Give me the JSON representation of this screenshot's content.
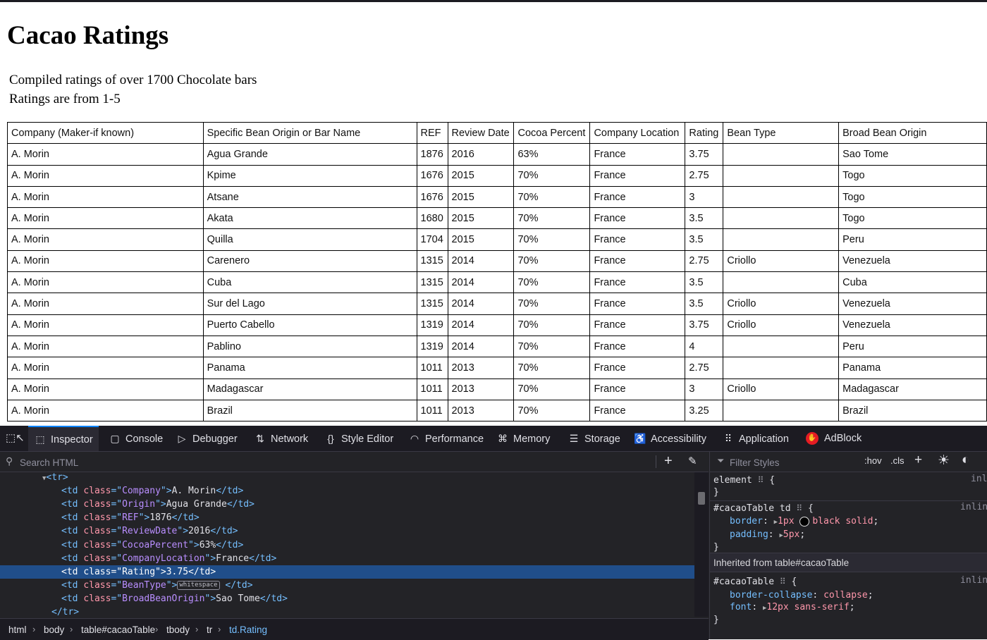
{
  "page": {
    "title": "Cacao Ratings",
    "subtitle_line1": "Compiled ratings of over 1700 Chocolate bars",
    "subtitle_line2": "Ratings are from 1-5"
  },
  "table": {
    "headers": [
      "Company  (Maker-if known)",
      "Specific Bean Origin or Bar Name",
      "REF",
      "Review Date",
      "Cocoa Percent",
      "Company Location",
      "Rating",
      "Bean Type",
      "Broad Bean Origin"
    ],
    "rows": [
      [
        "A. Morin",
        "Agua Grande",
        "1876",
        "2016",
        "63%",
        "France",
        "3.75",
        "",
        "Sao Tome"
      ],
      [
        "A. Morin",
        "Kpime",
        "1676",
        "2015",
        "70%",
        "France",
        "2.75",
        "",
        "Togo"
      ],
      [
        "A. Morin",
        "Atsane",
        "1676",
        "2015",
        "70%",
        "France",
        "3",
        "",
        "Togo"
      ],
      [
        "A. Morin",
        "Akata",
        "1680",
        "2015",
        "70%",
        "France",
        "3.5",
        "",
        "Togo"
      ],
      [
        "A. Morin",
        "Quilla",
        "1704",
        "2015",
        "70%",
        "France",
        "3.5",
        "",
        "Peru"
      ],
      [
        "A. Morin",
        "Carenero",
        "1315",
        "2014",
        "70%",
        "France",
        "2.75",
        "Criollo",
        "Venezuela"
      ],
      [
        "A. Morin",
        "Cuba",
        "1315",
        "2014",
        "70%",
        "France",
        "3.5",
        "",
        "Cuba"
      ],
      [
        "A. Morin",
        "Sur del Lago",
        "1315",
        "2014",
        "70%",
        "France",
        "3.5",
        "Criollo",
        "Venezuela"
      ],
      [
        "A. Morin",
        "Puerto Cabello",
        "1319",
        "2014",
        "70%",
        "France",
        "3.75",
        "Criollo",
        "Venezuela"
      ],
      [
        "A. Morin",
        "Pablino",
        "1319",
        "2014",
        "70%",
        "France",
        "4",
        "",
        "Peru"
      ],
      [
        "A. Morin",
        "Panama",
        "1011",
        "2013",
        "70%",
        "France",
        "2.75",
        "",
        "Panama"
      ],
      [
        "A. Morin",
        "Madagascar",
        "1011",
        "2013",
        "70%",
        "France",
        "3",
        "Criollo",
        "Madagascar"
      ],
      [
        "A. Morin",
        "Brazil",
        "1011",
        "2013",
        "70%",
        "France",
        "3.25",
        "",
        "Brazil"
      ]
    ]
  },
  "devtools": {
    "tabs": [
      {
        "label": "Inspector",
        "icon": "inspector-icon"
      },
      {
        "label": "Console",
        "icon": "console-icon"
      },
      {
        "label": "Debugger",
        "icon": "debugger-icon"
      },
      {
        "label": "Network",
        "icon": "network-icon"
      },
      {
        "label": "Style Editor",
        "icon": "style-editor-icon"
      },
      {
        "label": "Performance",
        "icon": "performance-icon"
      },
      {
        "label": "Memory",
        "icon": "memory-icon"
      },
      {
        "label": "Storage",
        "icon": "storage-icon"
      },
      {
        "label": "Accessibility",
        "icon": "accessibility-icon"
      },
      {
        "label": "Application",
        "icon": "application-icon"
      },
      {
        "label": "AdBlock",
        "icon": "adblock-icon"
      }
    ],
    "active_tab": "Inspector",
    "search_placeholder": "Search HTML",
    "html_tree": {
      "open_tag": "<tr>",
      "close_tag": "</tr>",
      "cells": [
        {
          "cls": "Company",
          "text": "A. Morin"
        },
        {
          "cls": "Origin",
          "text": "Agua Grande"
        },
        {
          "cls": "REF",
          "text": "1876"
        },
        {
          "cls": "ReviewDate",
          "text": "2016"
        },
        {
          "cls": "CocoaPercent",
          "text": "63%"
        },
        {
          "cls": "CompanyLocation",
          "text": "France"
        },
        {
          "cls": "Rating",
          "text": "3.75",
          "selected": true
        },
        {
          "cls": "BeanType",
          "text": "",
          "whitespace": "whitespace"
        },
        {
          "cls": "BroadBeanOrigin",
          "text": "Sao Tome"
        }
      ]
    },
    "breadcrumbs": [
      "html",
      "body",
      "table#cacaoTable",
      "tbody",
      "tr",
      "td.Rating"
    ],
    "styles": {
      "filter_placeholder": "Filter Styles",
      "hov": ":hov",
      "cls": ".cls",
      "element_selector": "element",
      "element_src": "inl",
      "rule1_selector": "#cacaoTable td",
      "rule1_src": "inlin",
      "rule1_border_prop": "border",
      "rule1_border_val_a": "1px",
      "rule1_border_val_b": "black solid",
      "rule1_padding_prop": "padding",
      "rule1_padding_val": "5px",
      "inherited_label": "Inherited from table#cacaoTable",
      "rule2_selector": "#cacaoTable",
      "rule2_src": "inlin",
      "rule2_bc_prop": "border-collapse",
      "rule2_bc_val": "collapse",
      "rule2_font_prop": "font",
      "rule2_font_val": "12px sans-serif"
    }
  }
}
